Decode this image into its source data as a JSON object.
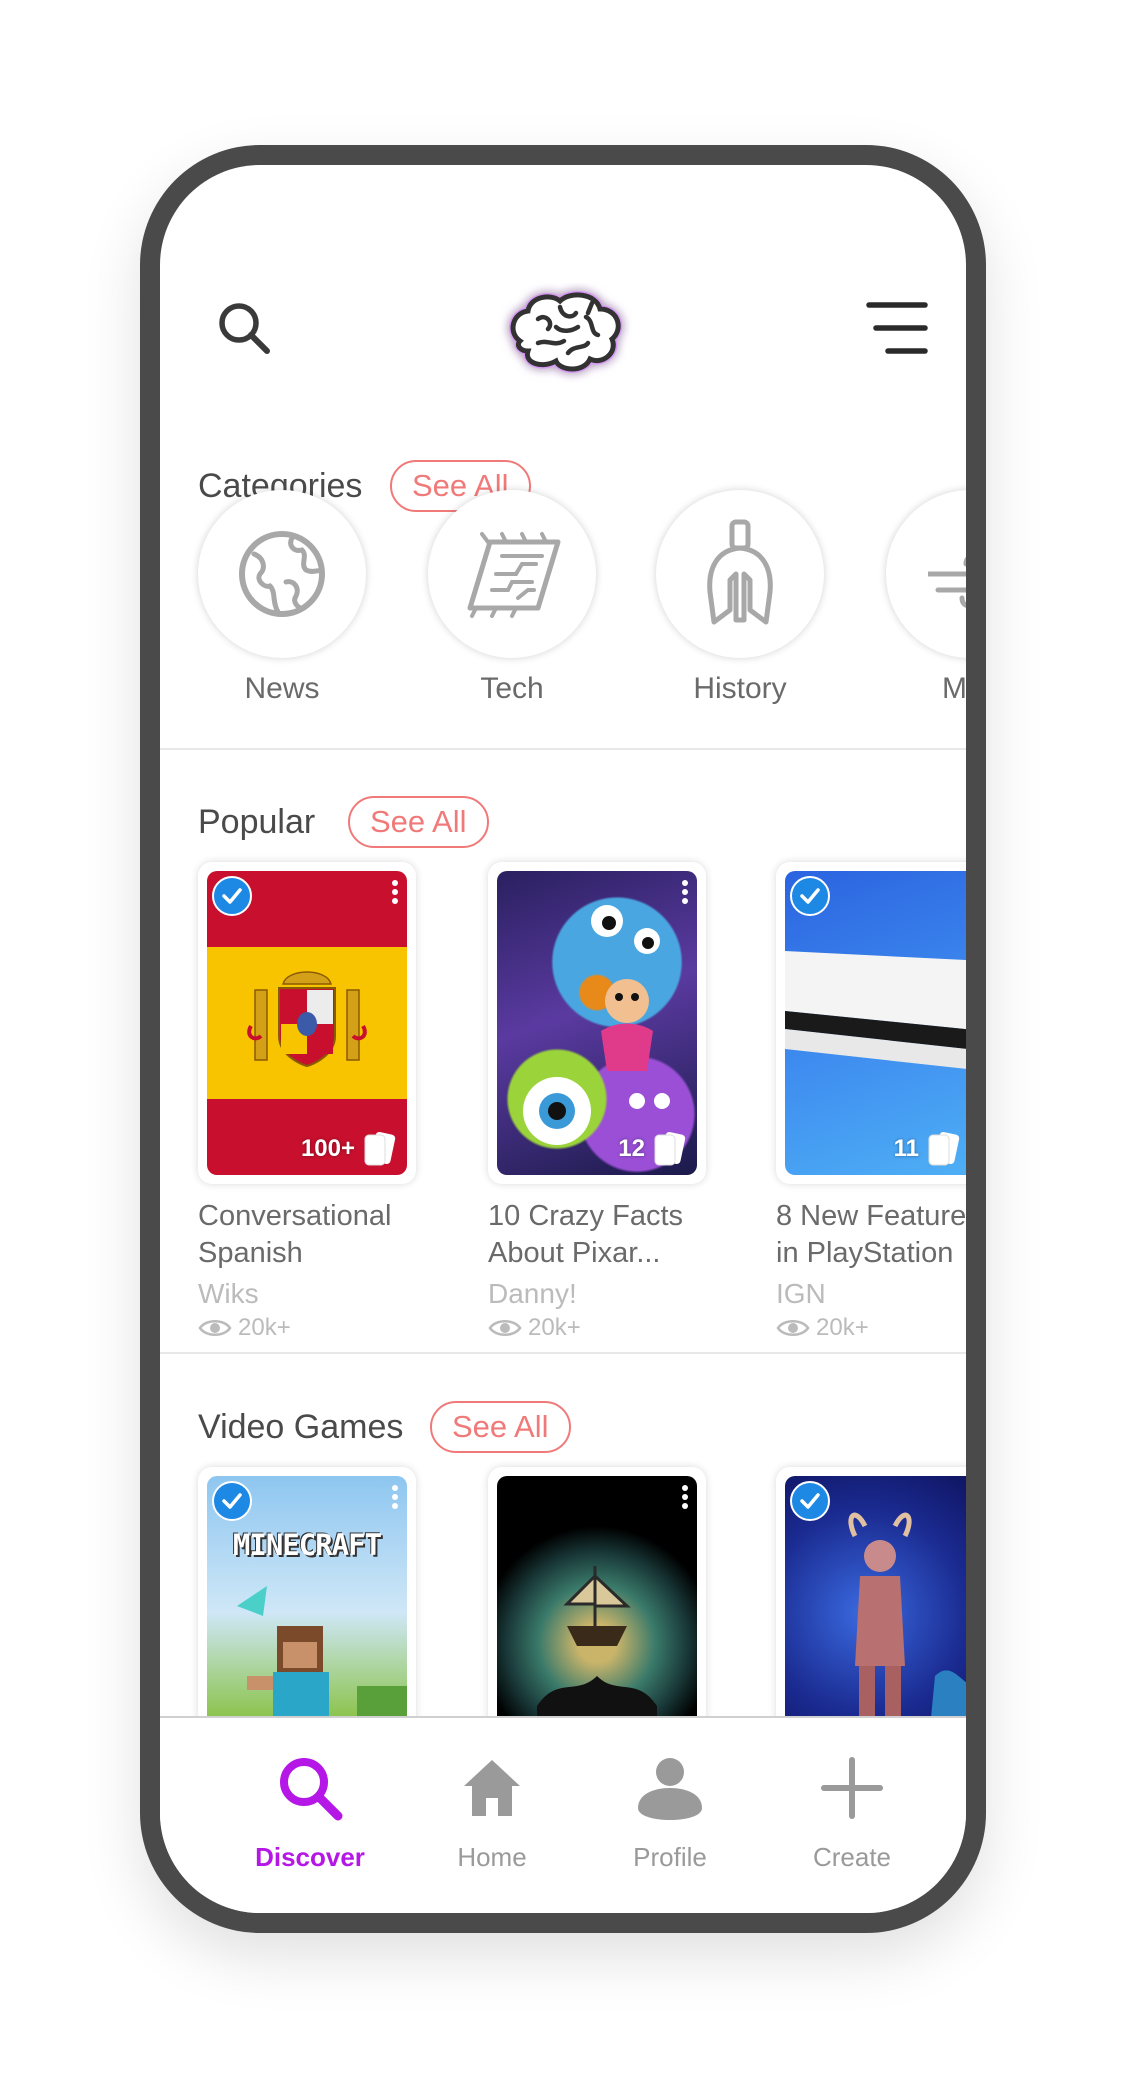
{
  "header": {
    "search_icon": "search-icon",
    "logo_icon": "brain-logo",
    "menu_icon": "menu-icon"
  },
  "categories": {
    "title": "Categories",
    "see_all": "See All",
    "items": [
      {
        "label": "News",
        "icon": "globe-icon"
      },
      {
        "label": "Tech",
        "icon": "circuit-board-icon"
      },
      {
        "label": "History",
        "icon": "spartan-helmet-icon"
      },
      {
        "label": "Ma",
        "icon": "wind-icon"
      }
    ]
  },
  "popular": {
    "title": "Popular",
    "see_all": "See All",
    "cards": [
      {
        "title_line1": "Conversational",
        "title_line2": "Spanish",
        "author": "Wiks",
        "views": "20k+",
        "count": "100+",
        "verified": true
      },
      {
        "title_line1": "10 Crazy Facts",
        "title_line2": "About Pixar...",
        "author": "Danny!",
        "views": "20k+",
        "count": "12",
        "verified": false
      },
      {
        "title_line1": "8 New Feature",
        "title_line2": "in PlayStation",
        "author": "IGN",
        "views": "20k+",
        "count": "11",
        "verified": true
      }
    ]
  },
  "video_games": {
    "title": "Video Games",
    "see_all": "See All",
    "cards": [
      {
        "image_text": "MINECRAFT",
        "verified": true
      },
      {
        "verified": false
      },
      {
        "verified": true
      }
    ]
  },
  "bottom_nav": {
    "items": [
      {
        "label": "Discover",
        "icon": "search-icon",
        "active": true
      },
      {
        "label": "Home",
        "icon": "home-icon",
        "active": false
      },
      {
        "label": "Profile",
        "icon": "profile-icon",
        "active": false
      },
      {
        "label": "Create",
        "icon": "plus-icon",
        "active": false
      }
    ]
  },
  "colors": {
    "accent": "#b517e6",
    "see_all": "#f07a7a",
    "verified": "#1e88e5",
    "frame": "#4a4a4a"
  }
}
